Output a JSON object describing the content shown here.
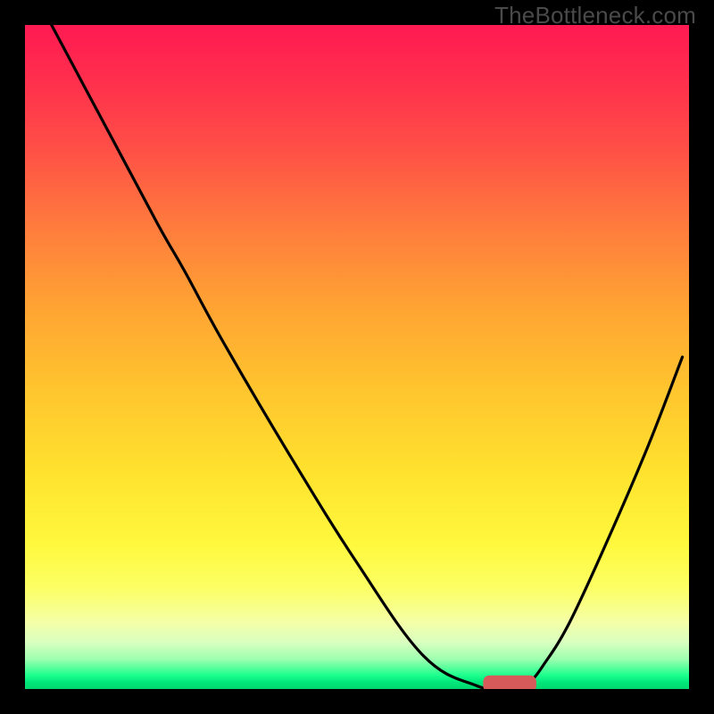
{
  "watermark": "TheBottleneck.com",
  "chart_data": {
    "type": "line",
    "title": "",
    "xlabel": "",
    "ylabel": "",
    "xlim": [
      0,
      100
    ],
    "ylim": [
      0,
      100
    ],
    "grid": false,
    "legend": false,
    "curve": {
      "x": [
        4,
        12,
        20,
        24,
        30,
        40,
        50,
        60,
        68,
        72,
        74.5,
        76,
        78,
        82,
        88,
        94,
        99
      ],
      "y": [
        100,
        85,
        70,
        63,
        52,
        35,
        19,
        5,
        0.5,
        0,
        0,
        1,
        3.5,
        10,
        23,
        37,
        50
      ],
      "description": "Percent value (0 at bottom, 100 at top) vs horizontal position percent"
    },
    "marker": {
      "x": 73,
      "y": 0.8,
      "width": 8,
      "height": 2.5,
      "color": "#d65a5a"
    }
  }
}
